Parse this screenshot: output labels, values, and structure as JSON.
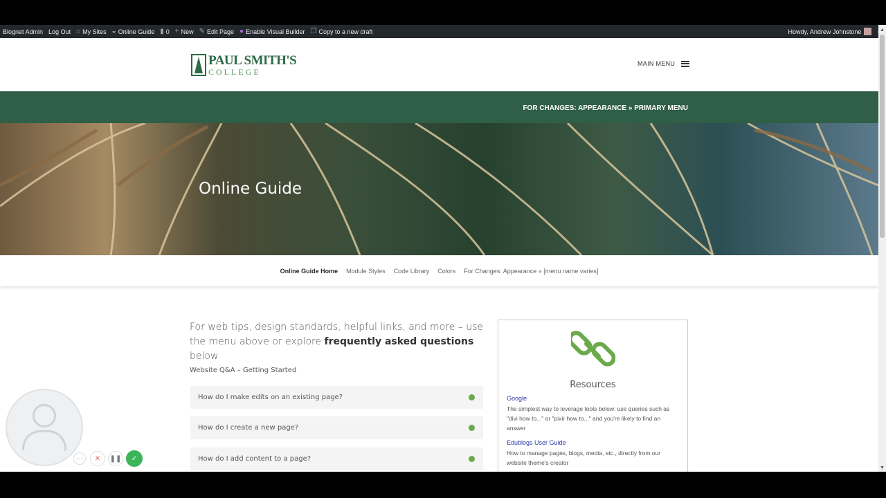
{
  "adminbar": {
    "items": [
      "Blognet Admin",
      "Log Out",
      "My Sites",
      "Online Guide",
      "0",
      "New",
      "Edit Page",
      "Enable Visual Builder",
      "Copy to a new draft"
    ],
    "greeting": "Howdy, Andrew Johnstone"
  },
  "header": {
    "logo_line1": "PAUL SMITH'S",
    "logo_line2": "COLLEGE",
    "menu_label": "MAIN MENU"
  },
  "band": {
    "text": "FOR CHANGES: APPEARANCE » PRIMARY MENU"
  },
  "hero": {
    "title": "Online Guide"
  },
  "subnav": {
    "items": [
      "Online Guide Home",
      "Module Styles",
      "Code Library",
      "Colors",
      "For Changes: Appearance » [menu name varies]"
    ]
  },
  "main": {
    "intro_part1": "For web tips, design standards, helpful links, and more – use the menu above or explore ",
    "intro_bold": "frequently asked questions",
    "intro_part2": " below",
    "qa_title": "Website Q&A – Getting Started",
    "questions": [
      "How do I make edits on an existing page?",
      "How do I create a new page?",
      "How do I add content to a page?"
    ],
    "accent_color": "#6aaa4a"
  },
  "resources": {
    "title": "Resources",
    "links": [
      {
        "label": "Google",
        "desc": "The simplest way to leverage tools below: use queries such as \"divi how to...\" or \"pixir how to...\" and you're likely to find an answer"
      },
      {
        "label": "Edublogs User Guide",
        "desc": "How to manage pages, blogs, media, etc., directly from our website theme's creator"
      }
    ]
  },
  "colors": {
    "brand_green": "#2f5f47",
    "admin_bar": "#23282d"
  }
}
